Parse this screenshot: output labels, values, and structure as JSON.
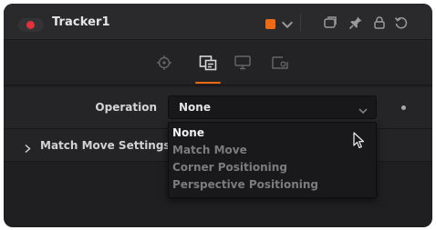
{
  "node": {
    "title": "Tracker1",
    "color_swatch": "#ef6a12",
    "status_dot_color": "#e3303b"
  },
  "titlebar_icons": [
    "color-picker-chevron-icon",
    "version-icon",
    "pin-icon",
    "lock-icon",
    "reset-icon"
  ],
  "tabs": [
    {
      "name": "controls-tab",
      "icon": "target-icon",
      "active": false
    },
    {
      "name": "operation-tab",
      "icon": "operation-icon",
      "active": true
    },
    {
      "name": "display-tab",
      "icon": "monitor-icon",
      "active": false
    },
    {
      "name": "settings-tab",
      "icon": "settings-icon",
      "active": false
    }
  ],
  "operation": {
    "label": "Operation",
    "value": "None",
    "options": [
      "None",
      "Match Move",
      "Corner Positioning",
      "Perspective Positioning"
    ],
    "selected_index": 0
  },
  "match_move": {
    "label": "Match Move Settings",
    "expanded": false
  }
}
